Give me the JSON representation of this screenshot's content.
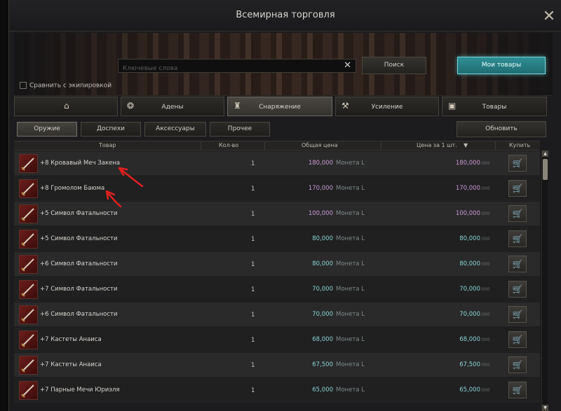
{
  "window": {
    "title": "Всемирная торговля",
    "close_icon": "close-icon"
  },
  "search": {
    "placeholder": "Ключевые слова",
    "value": ""
  },
  "buttons": {
    "search": "Поиск",
    "my_goods": "Мои товары",
    "refresh": "Обновить"
  },
  "compare_label": "Сравнить с экипировкой",
  "tabs": [
    {
      "label": "",
      "icon": "home-icon",
      "active": false
    },
    {
      "label": "Адены",
      "icon": "coins-icon",
      "active": false
    },
    {
      "label": "Снаряжение",
      "icon": "armor-icon",
      "active": true
    },
    {
      "label": "Усиление",
      "icon": "enhance-icon",
      "active": false
    },
    {
      "label": "Товары",
      "icon": "box-icon",
      "active": false
    }
  ],
  "subtabs": [
    {
      "label": "Оружие",
      "active": true
    },
    {
      "label": "Доспехи",
      "active": false
    },
    {
      "label": "Аксессуары",
      "active": false
    },
    {
      "label": "Прочее",
      "active": false
    }
  ],
  "table": {
    "headers": {
      "item": "Товар",
      "qty": "Кол-во",
      "total": "Общая цена",
      "unit": "Цена за 1 шт.",
      "buy": "Купить"
    },
    "rows": [
      {
        "name": "+8 Кровавый Меч Закена",
        "qty": "1",
        "total": "180,000",
        "currency": "Монета L",
        "unit": "180,000",
        "unit_suffix": ".000",
        "price_color": "#c79ad3"
      },
      {
        "name": "+8 Громолом Баюма",
        "qty": "1",
        "total": "170,000",
        "currency": "Монета L",
        "unit": "170,000",
        "unit_suffix": ".000",
        "price_color": "#c79ad3"
      },
      {
        "name": "+5 Символ Фатальности",
        "qty": "1",
        "total": "100,000",
        "currency": "Монета L",
        "unit": "100,000",
        "unit_suffix": ".000",
        "price_color": "#c79ad3"
      },
      {
        "name": "+5 Символ Фатальности",
        "qty": "1",
        "total": "80,000",
        "currency": "Монета L",
        "unit": "80,000",
        "unit_suffix": ".000",
        "price_color": "#8ad4d2"
      },
      {
        "name": "+6 Символ Фатальности",
        "qty": "1",
        "total": "80,000",
        "currency": "Монета L",
        "unit": "80,000",
        "unit_suffix": ".000",
        "price_color": "#8ad4d2"
      },
      {
        "name": "+7 Символ Фатальности",
        "qty": "1",
        "total": "70,000",
        "currency": "Монета L",
        "unit": "70,000",
        "unit_suffix": ".000",
        "price_color": "#8ad4d2"
      },
      {
        "name": "+6 Символ Фатальности",
        "qty": "1",
        "total": "70,000",
        "currency": "Монета L",
        "unit": "70,000",
        "unit_suffix": ".000",
        "price_color": "#8ad4d2"
      },
      {
        "name": "+7 Кастеты Анаиса",
        "qty": "1",
        "total": "68,000",
        "currency": "Монета L",
        "unit": "68,000",
        "unit_suffix": ".000",
        "price_color": "#8ad4d2"
      },
      {
        "name": "+7 Кастеты Анаиса",
        "qty": "1",
        "total": "67,500",
        "currency": "Монета L",
        "unit": "67,500",
        "unit_suffix": ".000",
        "price_color": "#8ad4d2"
      },
      {
        "name": "+7 Парные Мечи Юриэля",
        "qty": "1",
        "total": "65,000",
        "currency": "Монета L",
        "unit": "65,000",
        "unit_suffix": ".000",
        "price_color": "#8ad4d2"
      }
    ]
  }
}
